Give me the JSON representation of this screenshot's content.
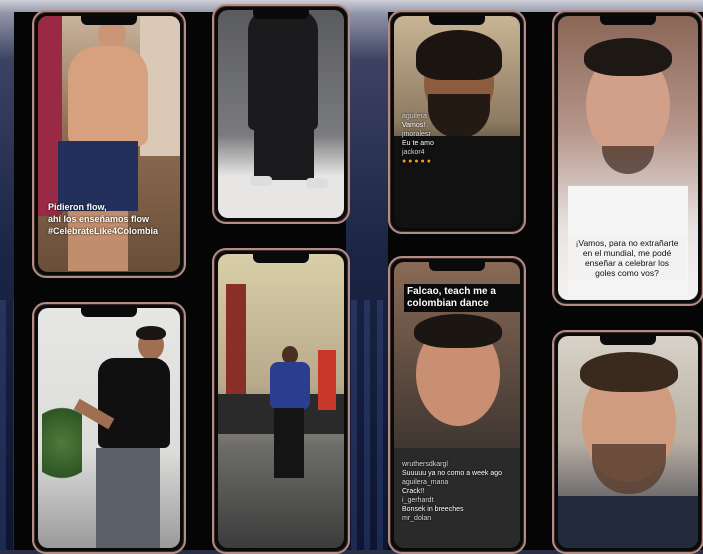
{
  "phones": {
    "p1": {
      "caption": "Pidieron flow,\nahí los enseñamos flow\n#CelebrateLike4Colombia"
    },
    "p5": {
      "caption": "Falcao, teach me a\ncolombian dance"
    },
    "p6": {
      "chat": [
        {
          "name": "wruthersdkargl",
          "msg": "Suuuuu ya no como a week ago"
        },
        {
          "name": "aguilera_mana",
          "msg": "Crack!!"
        },
        {
          "name": "i_gerhardt",
          "msg": "Bonsek in breeches"
        },
        {
          "name": "mr_dolan",
          "msg": ""
        }
      ]
    },
    "p7": {
      "caption": "¡Vamos, para no extrañarte\nen el mundial, me podé\nenseñar a celebrar los\ngoles como vos?"
    },
    "p3": {
      "chat": [
        {
          "name": "aguilera",
          "msg": "Vamos!"
        },
        {
          "name": "jmoralesr",
          "msg": "Eu te amo"
        },
        {
          "name": "jackor4",
          "msg": ""
        },
        {
          "name": "",
          "msg": "● ● ● ● ●"
        }
      ]
    }
  },
  "colors": {
    "frame": "#b48c86",
    "panel": "#050505"
  }
}
